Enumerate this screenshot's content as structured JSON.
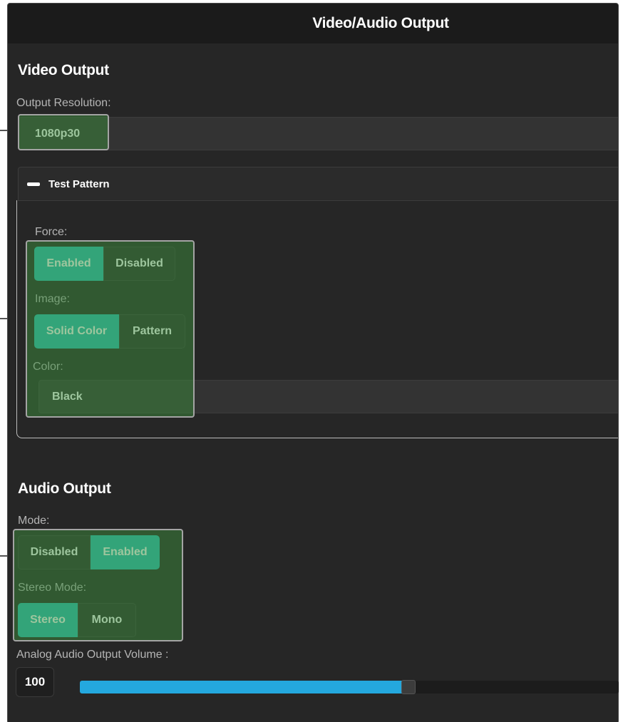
{
  "header": {
    "title": "Video/Audio Output"
  },
  "video_output": {
    "title": "Video Output",
    "resolution_label": "Output Resolution:",
    "resolution_value": "1080p30",
    "test_pattern": {
      "title": "Test Pattern",
      "force_label": "Force:",
      "force_options": [
        "Enabled",
        "Disabled"
      ],
      "force_selected": "Enabled",
      "image_label": "Image:",
      "image_options": [
        "Solid Color",
        "Pattern"
      ],
      "image_selected": "Solid Color",
      "color_label": "Color:",
      "color_value": "Black"
    }
  },
  "audio_output": {
    "title": "Audio Output",
    "mode_label": "Mode:",
    "mode_options": [
      "Disabled",
      "Enabled"
    ],
    "mode_selected": "Enabled",
    "stereo_label": "Stereo Mode:",
    "stereo_options": [
      "Stereo",
      "Mono"
    ],
    "stereo_selected": "Stereo",
    "volume_label": "Analog Audio Output Volume :",
    "volume_value": "100",
    "volume_fraction": 0.61
  },
  "colors": {
    "accent": "#2bbcb6",
    "slider_fill": "#24a8de",
    "highlight": "#3c8c3c",
    "background": "#262626"
  }
}
